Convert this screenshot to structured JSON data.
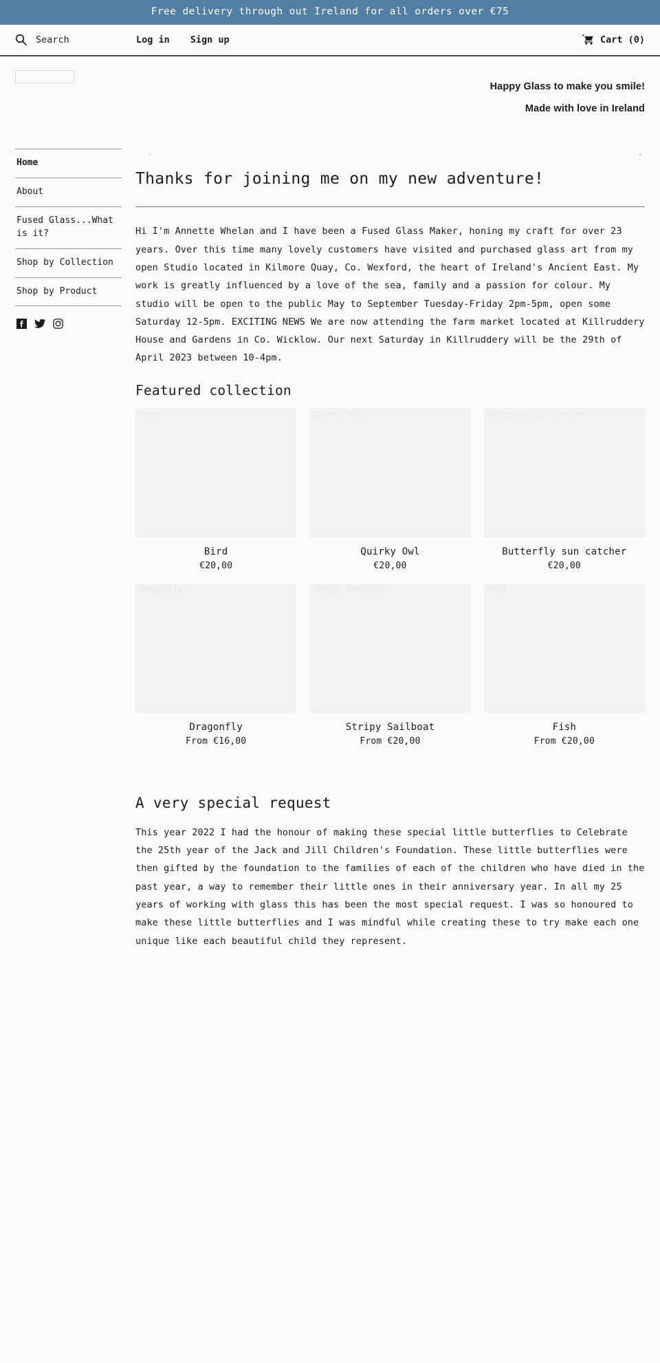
{
  "announcement": {
    "text": "Free delivery through out Ireland for all orders over €75",
    "background": "#507ea4",
    "color": "#ffffff"
  },
  "topbar": {
    "search_icon": "search-icon",
    "search_label": "Search",
    "login_label": "Log in",
    "signup_label": "Sign up",
    "cart_icon": "shopping-cart-icon",
    "cart_label": "Cart (0)"
  },
  "masthead": {
    "logo_alt": "",
    "tagline_1": "Happy Glass to make you smile!",
    "tagline_2": "Made with love in Ireland"
  },
  "sidebar": {
    "items": [
      {
        "label": "Home",
        "active": true
      },
      {
        "label": "About",
        "active": false
      },
      {
        "label": "Fused Glass...What is it?",
        "active": false
      },
      {
        "label": "Shop by Collection",
        "active": false
      },
      {
        "label": "Shop by Product",
        "active": false
      }
    ],
    "social": [
      {
        "name": "facebook-icon",
        "label": "Facebook"
      },
      {
        "name": "twitter-icon",
        "label": "Twitter"
      },
      {
        "name": "instagram-icon",
        "label": "Instagram"
      }
    ]
  },
  "slider": {
    "prev_glyph": "‹",
    "next_glyph": "‹"
  },
  "hero": {
    "title": "Thanks for joining me on my new adventure!",
    "body": "Hi I'm Annette Whelan and I have been a Fused Glass Maker, honing my craft for over 23 years. Over this time many lovely customers have visited and purchased glass art from my open Studio located in Kilmore Quay, Co. Wexford, the heart of Ireland's Ancient East. My work is greatly influenced by a love of the sea, family and a passion for colour. My studio will be open to the public May to September Tuesday-Friday 2pm-5pm, open some Saturday 12-5pm. EXCITING NEWS We are now attending the farm market located at Killruddery House and Gardens in Co. Wicklow. Our next Saturday in Killruddery will be the 29th of April 2023 between 10-4pm."
  },
  "featured": {
    "title": "Featured collection",
    "products": [
      {
        "name": "Bird",
        "price": "€20,00",
        "alt": "Bird"
      },
      {
        "name": "Quirky Owl",
        "price": "€20,00",
        "alt": "Quirky Owl"
      },
      {
        "name": "Butterfly sun catcher",
        "price": "€20,00",
        "alt": "Butterfly sun catcher"
      },
      {
        "name": "Dragonfly",
        "price": "From €16,00",
        "alt": "Dragonfly"
      },
      {
        "name": "Stripy Sailboat",
        "price": "From €20,00",
        "alt": "Stripy Sailboat"
      },
      {
        "name": "Fish",
        "price": "From €20,00",
        "alt": "Fish"
      }
    ]
  },
  "special": {
    "title": "A very special request",
    "body": "This year 2022 I had the honour of making these special little butterflies to Celebrate the 25th year of the Jack and Jill Children's Foundation. These little butterflies were then gifted by the foundation to the families of each of the children who have died in the past year, a way to remember their little ones in their anniversary year. In all my 25 years of working with glass this has been the most special request. I was so honoured to make these little butterflies and I was mindful while creating these to try make each one unique like each beautiful child they represent."
  }
}
